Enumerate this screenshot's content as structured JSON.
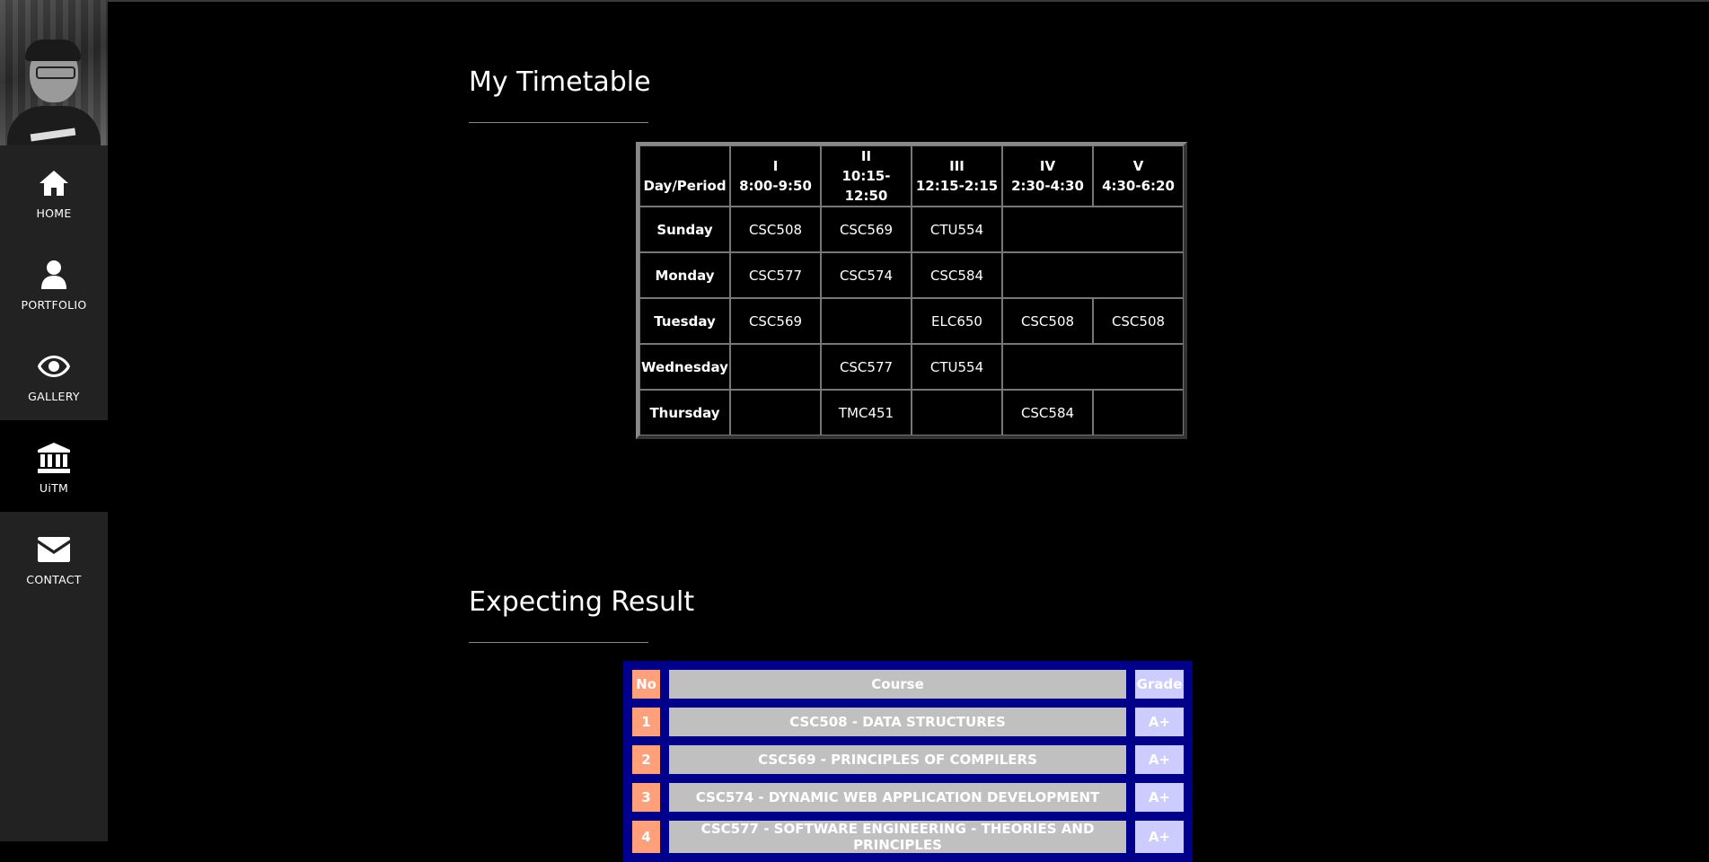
{
  "sidebar": {
    "items": [
      {
        "label": "HOME",
        "icon": "home-icon"
      },
      {
        "label": "PORTFOLIO",
        "icon": "user-icon"
      },
      {
        "label": "GALLERY",
        "icon": "eye-icon"
      },
      {
        "label": "UiTM",
        "icon": "institution-icon",
        "active": true
      },
      {
        "label": "CONTACT",
        "icon": "envelope-icon"
      }
    ]
  },
  "timetable": {
    "title": "My Timetable",
    "header": {
      "day_col": "Day/Period",
      "periods": [
        {
          "num": "I",
          "time": "8:00-9:50"
        },
        {
          "num": "II",
          "time": "10:15-12:50"
        },
        {
          "num": "III",
          "time": "12:15-2:15"
        },
        {
          "num": "IV",
          "time": "2:30-4:30"
        },
        {
          "num": "V",
          "time": "4:30-6:20"
        }
      ]
    },
    "rows": [
      {
        "day": "Sunday",
        "cells": [
          "CSC508",
          "CSC569",
          "CTU554",
          ""
        ]
      },
      {
        "day": "Monday",
        "cells": [
          "CSC577",
          "CSC574",
          "CSC584",
          ""
        ]
      },
      {
        "day": "Tuesday",
        "cells": [
          "CSC569",
          "",
          "ELC650",
          "CSC508",
          "CSC508"
        ]
      },
      {
        "day": "Wednesday",
        "cells": [
          "",
          "CSC577",
          "CTU554",
          ""
        ]
      },
      {
        "day": "Thursday",
        "cells": [
          "",
          "TMC451",
          "",
          "CSC584",
          ""
        ]
      }
    ]
  },
  "result": {
    "title": "Expecting Result",
    "header": {
      "no": "No",
      "course": "Course",
      "grade": "Grade"
    },
    "rows": [
      {
        "no": "1",
        "course": "CSC508 - DATA STRUCTURES",
        "grade": "A+"
      },
      {
        "no": "2",
        "course": "CSC569 - PRINCIPLES OF COMPILERS",
        "grade": "A+"
      },
      {
        "no": "3",
        "course": "CSC574 - DYNAMIC WEB APPLICATION DEVELOPMENT",
        "grade": "A+"
      },
      {
        "no": "4",
        "course": "CSC577 - SOFTWARE ENGINEERING - THEORIES AND PRINCIPLES",
        "grade": "A+"
      }
    ],
    "colors": {
      "no": "#ffa07a",
      "course": "#c0c0c0",
      "grade": "#ccccff",
      "frame": "#00008b"
    }
  }
}
